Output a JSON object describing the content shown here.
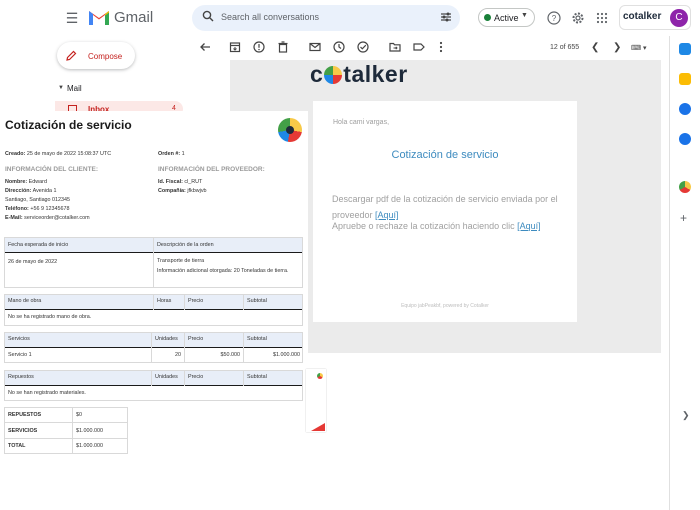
{
  "gmail": {
    "brand": "Gmail",
    "search_placeholder": "Search all conversations",
    "status": "Active",
    "account_logo": "cotalker",
    "avatar_initial": "C",
    "compose": "Compose",
    "mail_section": "Mail",
    "inbox_label": "Inbox",
    "inbox_count": "4",
    "pager": "12 of 655"
  },
  "email": {
    "brand": "cotalker",
    "greeting": "Hola cami vargas,",
    "title": "Cotización de servicio",
    "line1_text": "Descargar pdf de la cotización de servicio enviada por el proveedor",
    "line1_link": "[Aquí]",
    "line2_text": "Apruebe o rechaze la cotización haciendo clic",
    "line2_link": "[Aquí]",
    "footer": "Equipo jabPeakbf, powered by Cotalker"
  },
  "pdf": {
    "title": "Cotización de servicio",
    "created_label": "Creado:",
    "created_value": "25 de mayo de 2022 15:08:37 UTC",
    "order_label": "Orden #:",
    "order_value": "1",
    "client_heading": "INFORMACIÓN DEL CLIENTE:",
    "provider_heading": "INFORMACIÓN DEL PROVEEDOR:",
    "client_name_label": "Nombre:",
    "client_name": "Edward",
    "client_address_label": "Dirección:",
    "client_address_1": "Avenida 1",
    "client_address_2": "Santiago, Santiago 012345",
    "client_phone_label": "Teléfono:",
    "client_phone": "+56 9 12345678",
    "client_email_label": "E-Mail:",
    "client_email": "serviceorder@cotalker.com",
    "provider_fiscal_label": "Id. Fiscal:",
    "provider_fiscal": "cl_RUT",
    "provider_company_label": "Compañía:",
    "provider_company": "jfkbwjvb",
    "order_table": {
      "h1": "Fecha esperada de inicio",
      "h2": "Descripción de la orden",
      "date": "26 de mayo de 2022",
      "desc1": "Transporte de tierra",
      "desc2": "Información adicional otorgada: 20 Toneladas de tierra."
    },
    "labor_table": {
      "h1": "Mano de obra",
      "h2": "Horas",
      "h3": "Precio",
      "h4": "Subtotal",
      "empty": "No se ha registrado mano de obra."
    },
    "services_table": {
      "h1": "Servicios",
      "h2": "Unidades",
      "h3": "Precio",
      "h4": "Subtotal",
      "row_name": "Servicio 1",
      "row_units": "20",
      "row_price": "$50.000",
      "row_subtotal": "$1.000.000"
    },
    "parts_table": {
      "h1": "Repuestos",
      "h2": "Unidades",
      "h3": "Precio",
      "h4": "Subtotal",
      "empty": "No se han registrado materiales."
    },
    "summary": {
      "parts_label": "REPUESTOS",
      "parts_value": "$0",
      "services_label": "SERVICIOS",
      "services_value": "$1.000.000",
      "total_label": "TOTAL",
      "total_value": "$1.000.000"
    }
  },
  "colors": {
    "accent": "#3d8bbf",
    "gmail_red": "#c5221f",
    "active_green": "#188038",
    "avatar": "#8e24aa",
    "table_header": "#e8eef8"
  }
}
